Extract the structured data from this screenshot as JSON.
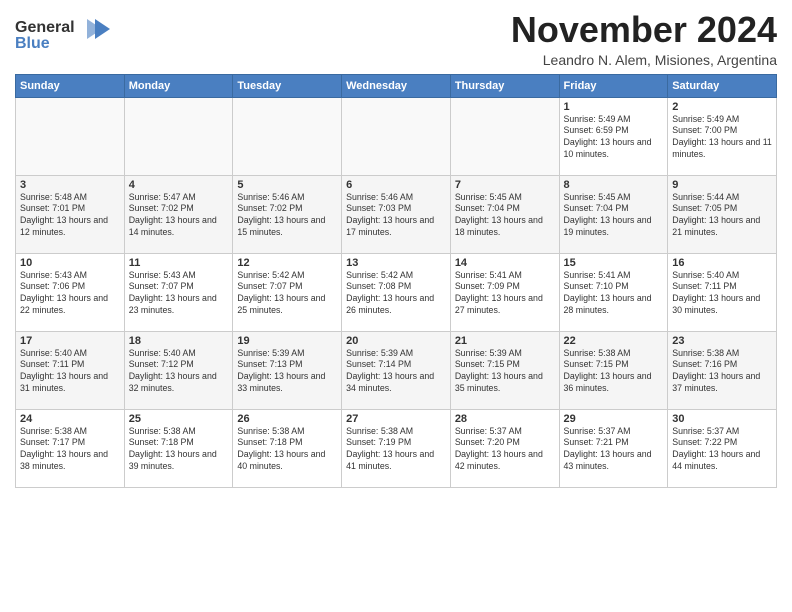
{
  "logo": {
    "line1": "General",
    "line2": "Blue"
  },
  "title": "November 2024",
  "subtitle": "Leandro N. Alem, Misiones, Argentina",
  "days_of_week": [
    "Sunday",
    "Monday",
    "Tuesday",
    "Wednesday",
    "Thursday",
    "Friday",
    "Saturday"
  ],
  "weeks": [
    [
      {
        "day": "",
        "info": ""
      },
      {
        "day": "",
        "info": ""
      },
      {
        "day": "",
        "info": ""
      },
      {
        "day": "",
        "info": ""
      },
      {
        "day": "",
        "info": ""
      },
      {
        "day": "1",
        "info": "Sunrise: 5:49 AM\nSunset: 6:59 PM\nDaylight: 13 hours and 10 minutes."
      },
      {
        "day": "2",
        "info": "Sunrise: 5:49 AM\nSunset: 7:00 PM\nDaylight: 13 hours and 11 minutes."
      }
    ],
    [
      {
        "day": "3",
        "info": "Sunrise: 5:48 AM\nSunset: 7:01 PM\nDaylight: 13 hours and 12 minutes."
      },
      {
        "day": "4",
        "info": "Sunrise: 5:47 AM\nSunset: 7:02 PM\nDaylight: 13 hours and 14 minutes."
      },
      {
        "day": "5",
        "info": "Sunrise: 5:46 AM\nSunset: 7:02 PM\nDaylight: 13 hours and 15 minutes."
      },
      {
        "day": "6",
        "info": "Sunrise: 5:46 AM\nSunset: 7:03 PM\nDaylight: 13 hours and 17 minutes."
      },
      {
        "day": "7",
        "info": "Sunrise: 5:45 AM\nSunset: 7:04 PM\nDaylight: 13 hours and 18 minutes."
      },
      {
        "day": "8",
        "info": "Sunrise: 5:45 AM\nSunset: 7:04 PM\nDaylight: 13 hours and 19 minutes."
      },
      {
        "day": "9",
        "info": "Sunrise: 5:44 AM\nSunset: 7:05 PM\nDaylight: 13 hours and 21 minutes."
      }
    ],
    [
      {
        "day": "10",
        "info": "Sunrise: 5:43 AM\nSunset: 7:06 PM\nDaylight: 13 hours and 22 minutes."
      },
      {
        "day": "11",
        "info": "Sunrise: 5:43 AM\nSunset: 7:07 PM\nDaylight: 13 hours and 23 minutes."
      },
      {
        "day": "12",
        "info": "Sunrise: 5:42 AM\nSunset: 7:07 PM\nDaylight: 13 hours and 25 minutes."
      },
      {
        "day": "13",
        "info": "Sunrise: 5:42 AM\nSunset: 7:08 PM\nDaylight: 13 hours and 26 minutes."
      },
      {
        "day": "14",
        "info": "Sunrise: 5:41 AM\nSunset: 7:09 PM\nDaylight: 13 hours and 27 minutes."
      },
      {
        "day": "15",
        "info": "Sunrise: 5:41 AM\nSunset: 7:10 PM\nDaylight: 13 hours and 28 minutes."
      },
      {
        "day": "16",
        "info": "Sunrise: 5:40 AM\nSunset: 7:11 PM\nDaylight: 13 hours and 30 minutes."
      }
    ],
    [
      {
        "day": "17",
        "info": "Sunrise: 5:40 AM\nSunset: 7:11 PM\nDaylight: 13 hours and 31 minutes."
      },
      {
        "day": "18",
        "info": "Sunrise: 5:40 AM\nSunset: 7:12 PM\nDaylight: 13 hours and 32 minutes."
      },
      {
        "day": "19",
        "info": "Sunrise: 5:39 AM\nSunset: 7:13 PM\nDaylight: 13 hours and 33 minutes."
      },
      {
        "day": "20",
        "info": "Sunrise: 5:39 AM\nSunset: 7:14 PM\nDaylight: 13 hours and 34 minutes."
      },
      {
        "day": "21",
        "info": "Sunrise: 5:39 AM\nSunset: 7:15 PM\nDaylight: 13 hours and 35 minutes."
      },
      {
        "day": "22",
        "info": "Sunrise: 5:38 AM\nSunset: 7:15 PM\nDaylight: 13 hours and 36 minutes."
      },
      {
        "day": "23",
        "info": "Sunrise: 5:38 AM\nSunset: 7:16 PM\nDaylight: 13 hours and 37 minutes."
      }
    ],
    [
      {
        "day": "24",
        "info": "Sunrise: 5:38 AM\nSunset: 7:17 PM\nDaylight: 13 hours and 38 minutes."
      },
      {
        "day": "25",
        "info": "Sunrise: 5:38 AM\nSunset: 7:18 PM\nDaylight: 13 hours and 39 minutes."
      },
      {
        "day": "26",
        "info": "Sunrise: 5:38 AM\nSunset: 7:18 PM\nDaylight: 13 hours and 40 minutes."
      },
      {
        "day": "27",
        "info": "Sunrise: 5:38 AM\nSunset: 7:19 PM\nDaylight: 13 hours and 41 minutes."
      },
      {
        "day": "28",
        "info": "Sunrise: 5:37 AM\nSunset: 7:20 PM\nDaylight: 13 hours and 42 minutes."
      },
      {
        "day": "29",
        "info": "Sunrise: 5:37 AM\nSunset: 7:21 PM\nDaylight: 13 hours and 43 minutes."
      },
      {
        "day": "30",
        "info": "Sunrise: 5:37 AM\nSunset: 7:22 PM\nDaylight: 13 hours and 44 minutes."
      }
    ]
  ]
}
